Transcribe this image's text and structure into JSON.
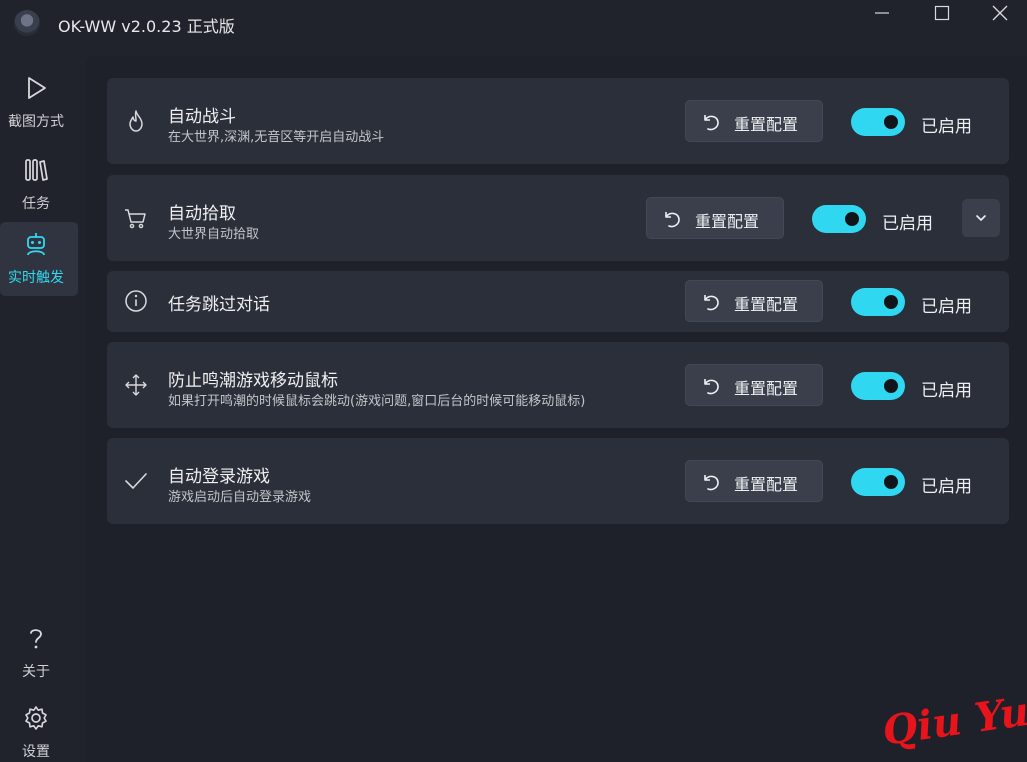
{
  "window": {
    "title": "OK-WW v2.0.23 正式版"
  },
  "sidebar": {
    "items": [
      {
        "label": "截图方式",
        "icon": "play-icon"
      },
      {
        "label": "任务",
        "icon": "library-icon"
      },
      {
        "label": "实时触发",
        "icon": "robot-icon",
        "active": true
      }
    ],
    "bottom_items": [
      {
        "label": "关于",
        "icon": "help-icon"
      },
      {
        "label": "设置",
        "icon": "gear-icon"
      }
    ]
  },
  "cards": [
    {
      "title": "自动战斗",
      "description": "在大世界,深渊,无音区等开启自动战斗",
      "icon": "fire-icon",
      "reset_label": "重置配置",
      "status": "已启用",
      "enabled": true
    },
    {
      "title": "自动拾取",
      "description": "大世界自动拾取",
      "icon": "cart-icon",
      "reset_label": "重置配置",
      "status": "已启用",
      "enabled": true,
      "expandable": true
    },
    {
      "title": "任务跳过对话",
      "description": "",
      "icon": "info-icon",
      "reset_label": "重置配置",
      "status": "已启用",
      "enabled": true
    },
    {
      "title": "防止鸣潮游戏移动鼠标",
      "description": "如果打开鸣潮的时候鼠标会跳动(游戏问题,窗口后台的时候可能移动鼠标)",
      "icon": "move-icon",
      "reset_label": "重置配置",
      "status": "已启用",
      "enabled": true
    },
    {
      "title": "自动登录游戏",
      "description": "游戏启动后自动登录游戏",
      "icon": "check-icon",
      "reset_label": "重置配置",
      "status": "已启用",
      "enabled": true
    }
  ],
  "watermark": "Qiu  Yue",
  "colors": {
    "accent": "#2fd8f0",
    "background": "#20232b",
    "card": "#2b2f39"
  }
}
